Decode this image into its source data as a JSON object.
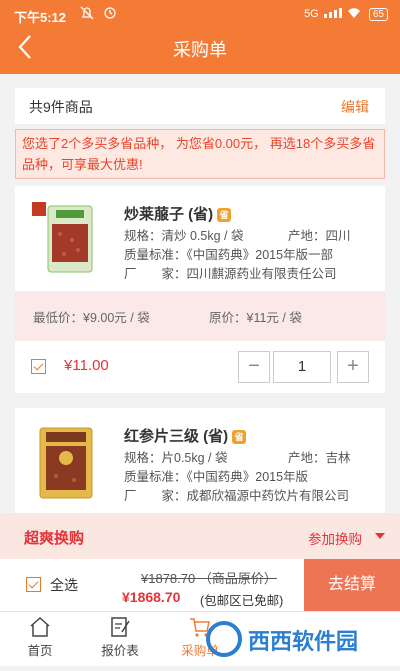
{
  "status_bar": {
    "time": "下午5:12",
    "network": "5G",
    "battery": "65"
  },
  "header": {
    "title": "采购单"
  },
  "summary": {
    "count_label": "共9件商品",
    "edit_label": "编辑"
  },
  "promo": {
    "text": "您选了2个多买多省品种， 为您省0.00元， 再选18个多买多省品种，可享最大优惠!"
  },
  "products": [
    {
      "name": "炒莱菔子 (省)",
      "badge": "省",
      "spec": "规格：清炒 0.5kg / 袋",
      "origin": "产地：四川",
      "standard": "质量标准：《中国药典》2015年版一部",
      "maker_label": "厂　　家：",
      "maker": "四川麒源药业有限责任公司",
      "min_price": "最低价：¥9.00元 / 袋",
      "orig_price": "原价：¥11元 / 袋",
      "price": "¥11.00",
      "qty": "1"
    },
    {
      "name": "红参片三级 (省)",
      "badge": "省",
      "spec": "规格：片0.5kg / 袋",
      "origin": "产地：吉林",
      "standard": "质量标准：《中国药典》2015年版",
      "maker_label": "厂　　家：",
      "maker": "成都欣福源中药饮片有限公司"
    }
  ],
  "swap": {
    "title": "超爽换购",
    "action": "参加换购"
  },
  "checkout": {
    "select_all": "全选",
    "original_total": "¥1878.70 （商品原价）",
    "total": "¥1868.70",
    "shipping_note": "(包邮区已免邮)",
    "button": "去结算"
  },
  "tabs": [
    {
      "label": "首页",
      "icon": "home-icon"
    },
    {
      "label": "报价表",
      "icon": "quote-icon"
    },
    {
      "label": "采购单",
      "icon": "cart-icon"
    }
  ],
  "watermark": "西西软件园",
  "colors": {
    "primary": "#f47b35",
    "accent_red": "#e3343a",
    "checkout": "#ee7456",
    "promo_bg": "#fde8e2"
  }
}
